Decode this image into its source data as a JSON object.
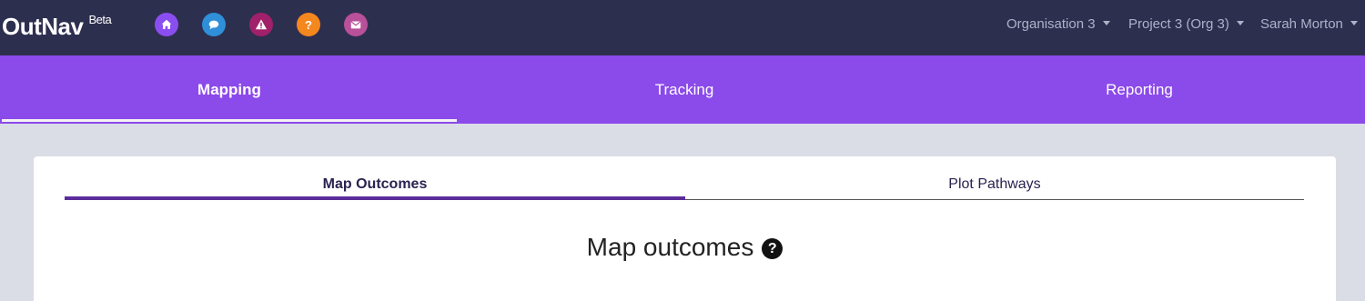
{
  "brand": {
    "name": "OutNav",
    "badge": "Beta"
  },
  "toolbar_icons": [
    {
      "name": "home-icon",
      "color": "#8a4ef0"
    },
    {
      "name": "chat-icon",
      "color": "#2f8fd8"
    },
    {
      "name": "warning-icon",
      "color": "#a0206a"
    },
    {
      "name": "help-icon",
      "color": "#f5871f",
      "glyph": "?"
    },
    {
      "name": "mail-icon",
      "color": "#b8509a"
    }
  ],
  "top_nav": {
    "organisation": "Organisation 3",
    "project": "Project 3 (Org 3)",
    "user": "Sarah Morton"
  },
  "main_tabs": [
    {
      "label": "Mapping",
      "active": true
    },
    {
      "label": "Tracking",
      "active": false
    },
    {
      "label": "Reporting",
      "active": false
    }
  ],
  "sub_tabs": [
    {
      "label": "Map Outcomes",
      "active": true
    },
    {
      "label": "Plot Pathways",
      "active": false
    }
  ],
  "page": {
    "heading": "Map outcomes",
    "help_glyph": "?"
  },
  "colors": {
    "topbar": "#2d2f4f",
    "nav_purple": "#8b4aea",
    "active_underline": "#5b2d9a",
    "background": "#dadde6"
  }
}
